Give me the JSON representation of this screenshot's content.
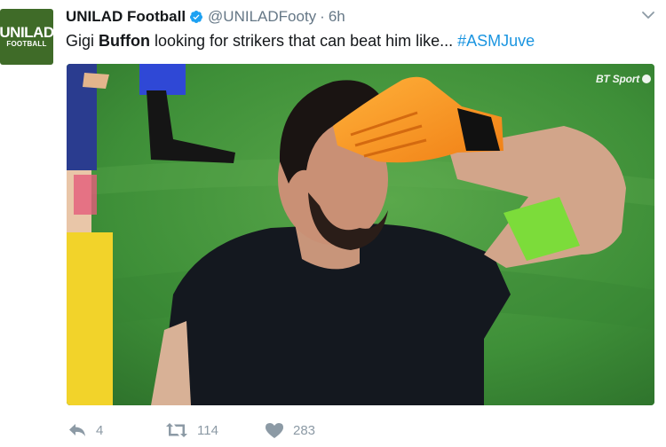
{
  "avatar": {
    "line1": "UNILAD",
    "line2": "FOOTBALL",
    "color": "#3f6b28"
  },
  "header": {
    "name": "UNILAD Football",
    "verified_icon": "verified-badge-icon",
    "handle": "@UNILADFooty",
    "separator": "·",
    "time": "6h",
    "menu_icon": "chevron-down-icon"
  },
  "tweet": {
    "text_before": "Gigi ",
    "text_bold": "Buffon",
    "text_after": " looking for strikers that can beat him like... ",
    "hashtag": "#ASMJuve"
  },
  "media": {
    "watermark": "BT Sport",
    "description_icon": "photo"
  },
  "actions": {
    "reply_icon": "reply-icon",
    "reply_count": "4",
    "retweet_icon": "retweet-icon",
    "retweet_count": "114",
    "like_icon": "heart-icon",
    "like_count": "283"
  },
  "colors": {
    "link": "#1b95e0",
    "muted": "#657786",
    "action": "#8c9aa5",
    "verified": "#1da1f2"
  }
}
